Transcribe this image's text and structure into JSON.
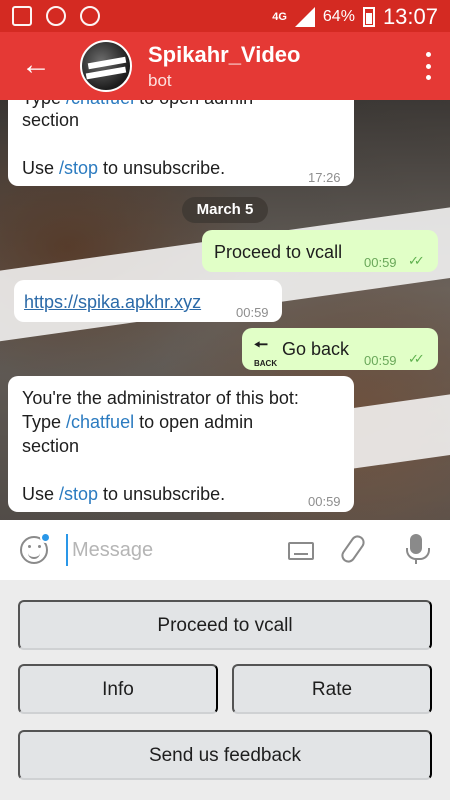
{
  "status_bar": {
    "network": "4G",
    "battery": "64%",
    "time": "13:07"
  },
  "header": {
    "title": "Spikahr_Video",
    "subtitle": "bot"
  },
  "messages": [
    {
      "direction": "in",
      "line1_text": "Type ",
      "line1_cmd": "/chatfuel",
      "line1_rest": " to open admin",
      "line2": "section",
      "line3_pre": "Use ",
      "line3_cmd": "/stop",
      "line3_post": " to unsubscribe.",
      "time": "17:26"
    },
    {
      "direction": "out",
      "text": "Proceed to vcall",
      "time": "00:59"
    },
    {
      "direction": "in",
      "link": "https://spika.apkhr.xyz",
      "time": "00:59"
    },
    {
      "direction": "out",
      "badge_label": "BACK",
      "text": "Go back",
      "time": "00:59"
    },
    {
      "direction": "in",
      "line0": "You're the administrator of this bot:",
      "line1_text": "Type ",
      "line1_cmd": "/chatfuel",
      "line1_rest": " to open admin",
      "line2": "section",
      "line3_pre": "Use ",
      "line3_cmd": "/stop",
      "line3_post": " to unsubscribe.",
      "time": "00:59"
    }
  ],
  "date_separator": "March 5",
  "input": {
    "placeholder": "Message"
  },
  "bot_keyboard": {
    "proceed": "Proceed to vcall",
    "info": "Info",
    "rate": "Rate",
    "feedback": "Send us feedback"
  },
  "colors": {
    "status_bar": "#d42a22",
    "header": "#e53935",
    "outgoing_bubble": "#e1ffc7",
    "command_link": "#2b7bc0"
  }
}
